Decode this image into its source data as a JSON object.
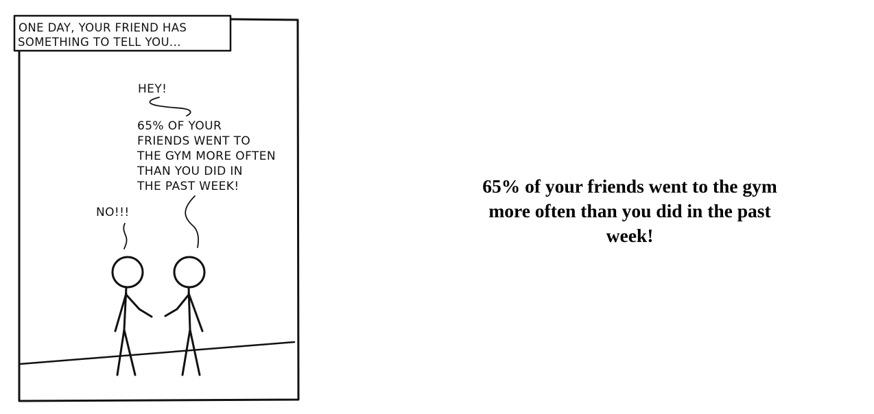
{
  "comic": {
    "caption_lines": [
      "ONE DAY, YOUR FRIEND HAS",
      "SOMETHING TO TELL YOU..."
    ],
    "friend_speech": {
      "greeting": "HEY!",
      "lines": [
        "65% OF YOUR",
        "FRIENDS WENT TO",
        "THE GYM MORE OFTEN",
        "THAN YOU DID IN",
        "THE PAST WEEK!"
      ]
    },
    "you_speech": "NO!!!"
  },
  "statement": "65% of your friends went to the gym more often than you did in the past week!"
}
